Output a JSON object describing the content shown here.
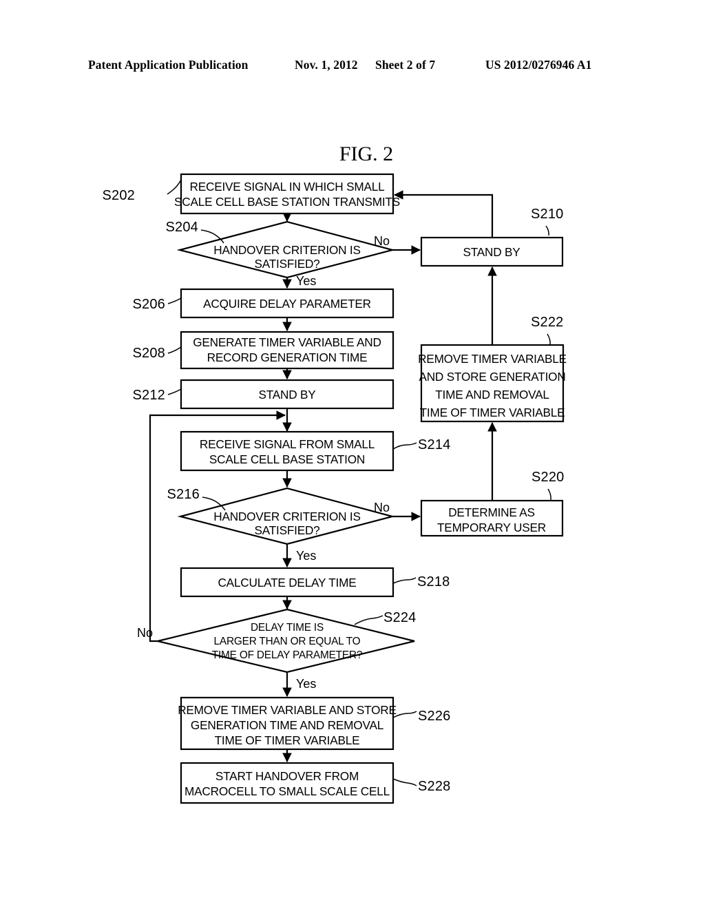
{
  "header": {
    "publication": "Patent Application Publication",
    "date": "Nov. 1, 2012",
    "sheet": "Sheet 2 of 7",
    "number": "US 2012/0276946 A1"
  },
  "figure": {
    "title": "FIG. 2"
  },
  "nodes": {
    "s202": {
      "id": "S202",
      "shape": "process",
      "lines": [
        "RECEIVE SIGNAL IN WHICH SMALL",
        "SCALE CELL BASE STATION TRANSMITS"
      ]
    },
    "s204": {
      "id": "S204",
      "shape": "decision",
      "lines": [
        "HANDOVER CRITERION IS",
        "SATISFIED?"
      ]
    },
    "s210": {
      "id": "S210",
      "shape": "process",
      "lines": [
        "STAND BY"
      ]
    },
    "s206": {
      "id": "S206",
      "shape": "process",
      "lines": [
        "ACQUIRE DELAY PARAMETER"
      ]
    },
    "s208": {
      "id": "S208",
      "shape": "process",
      "lines": [
        "GENERATE TIMER VARIABLE AND",
        "RECORD GENERATION TIME"
      ]
    },
    "s212": {
      "id": "S212",
      "shape": "process",
      "lines": [
        "STAND BY"
      ]
    },
    "s222": {
      "id": "S222",
      "shape": "process",
      "lines": [
        "REMOVE TIMER VARIABLE",
        "AND STORE GENERATION",
        "TIME AND REMOVAL",
        "TIME OF TIMER VARIABLE"
      ]
    },
    "s214": {
      "id": "S214",
      "shape": "process",
      "lines": [
        "RECEIVE SIGNAL FROM SMALL",
        "SCALE CELL BASE STATION"
      ]
    },
    "s216": {
      "id": "S216",
      "shape": "decision",
      "lines": [
        "HANDOVER CRITERION IS",
        "SATISFIED?"
      ]
    },
    "s220": {
      "id": "S220",
      "shape": "process",
      "lines": [
        "DETERMINE AS",
        "TEMPORARY USER"
      ]
    },
    "s218": {
      "id": "S218",
      "shape": "process",
      "lines": [
        "CALCULATE DELAY TIME"
      ]
    },
    "s224": {
      "id": "S224",
      "shape": "decision",
      "lines": [
        "DELAY TIME IS",
        "LARGER THAN OR EQUAL TO",
        "TIME OF DELAY PARAMETER?"
      ]
    },
    "s226": {
      "id": "S226",
      "shape": "process",
      "lines": [
        "REMOVE TIMER VARIABLE AND STORE",
        "GENERATION TIME AND REMOVAL",
        "TIME OF TIMER VARIABLE"
      ]
    },
    "s228": {
      "id": "S228",
      "shape": "process",
      "lines": [
        "START HANDOVER FROM",
        "MACROCELL TO SMALL SCALE CELL"
      ]
    }
  },
  "branches": {
    "s204_no": "No",
    "s204_yes": "Yes",
    "s216_no": "No",
    "s216_yes": "Yes",
    "s224_no": "No",
    "s224_yes": "Yes"
  },
  "colors": {
    "ink": "#000000",
    "paper": "#ffffff"
  }
}
